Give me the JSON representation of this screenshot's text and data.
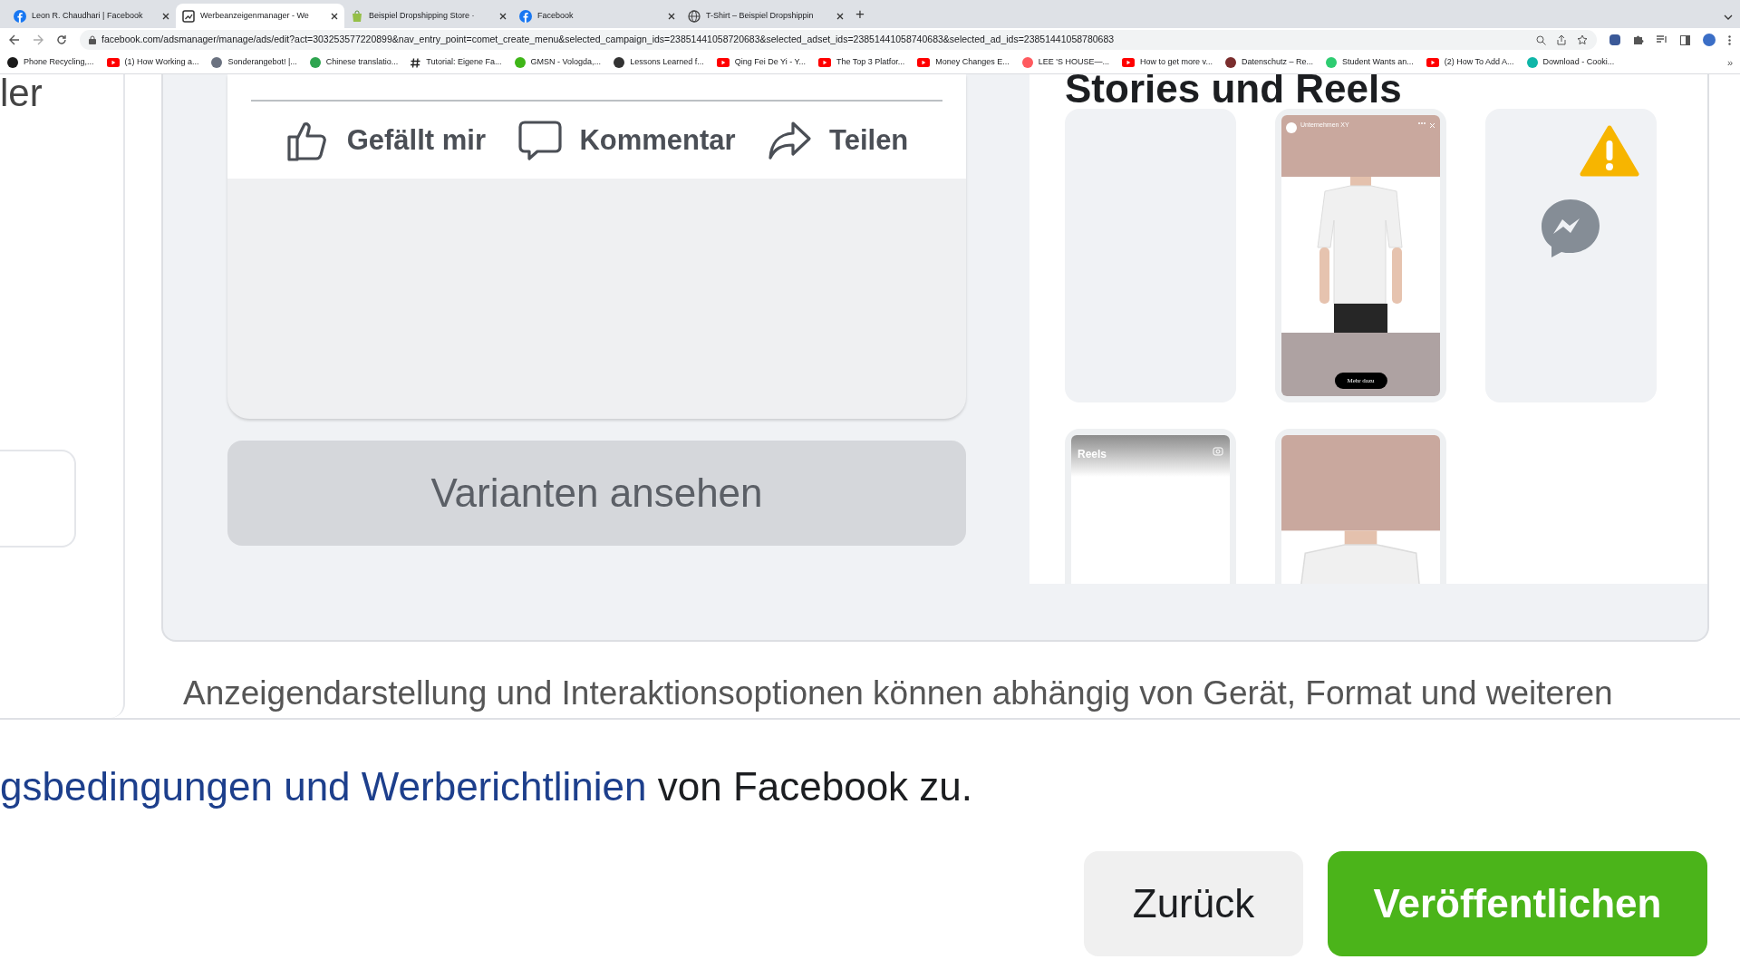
{
  "browser": {
    "tabs": [
      {
        "title": "Leon R. Chaudhari | Facebook",
        "kind": "facebook",
        "selected": false
      },
      {
        "title": "Werbeanzeigenmanager - We",
        "kind": "adsmanager",
        "selected": true
      },
      {
        "title": "Beispiel Dropshipping Store ·",
        "kind": "shop",
        "selected": false
      },
      {
        "title": "Facebook",
        "kind": "facebook",
        "selected": false
      },
      {
        "title": "T-Shirt – Beispiel Dropshippin",
        "kind": "globe",
        "selected": false
      }
    ],
    "new_tab": "+",
    "address": "facebook.com/adsmanager/manage/ads/edit?act=303253577220899&nav_entry_point=comet_create_menu&selected_campaign_ids=23851441058720683&selected_adset_ids=23851441058740683&selected_ad_ids=23851441058780683",
    "bookmarks": [
      {
        "label": "Phone Recycling,...",
        "kind": "dot",
        "color": "#1a1a1a"
      },
      {
        "label": "(1) How Working a...",
        "kind": "youtube"
      },
      {
        "label": "Sonderangebot! |...",
        "kind": "dot",
        "color": "#6b7280"
      },
      {
        "label": "Chinese translatio...",
        "kind": "dot",
        "color": "#2ea44f"
      },
      {
        "label": "Tutorial: Eigene Fa...",
        "kind": "hash"
      },
      {
        "label": "GMSN - Vologda,...",
        "kind": "dot",
        "color": "#3fb618"
      },
      {
        "label": "Lessons Learned f...",
        "kind": "dot",
        "color": "#333333"
      },
      {
        "label": "Qing Fei De Yi - Y...",
        "kind": "youtube"
      },
      {
        "label": "The Top 3 Platfor...",
        "kind": "youtube"
      },
      {
        "label": "Money Changes E...",
        "kind": "youtube"
      },
      {
        "label": "LEE 'S HOUSE—...",
        "kind": "dot",
        "color": "#ff5a5f"
      },
      {
        "label": "How to get more v...",
        "kind": "youtube"
      },
      {
        "label": "Datenschutz – Re...",
        "kind": "dot",
        "color": "#7a2d2d"
      },
      {
        "label": "Student Wants an...",
        "kind": "dot",
        "color": "#2ecc71"
      },
      {
        "label": "(2) How To Add A...",
        "kind": "youtube"
      },
      {
        "label": "Download - Cooki...",
        "kind": "dot",
        "color": "#0fb6a8"
      }
    ],
    "more_bookmarks": "»"
  },
  "left_panel": {
    "heading": "ler"
  },
  "preview": {
    "actions": [
      {
        "label": "Gefällt mir",
        "kind": "like"
      },
      {
        "label": "Kommentar",
        "kind": "comment"
      },
      {
        "label": "Teilen",
        "kind": "share"
      }
    ],
    "variants_button": "Varianten ansehen"
  },
  "stories": {
    "heading": "Stories und Reels",
    "cards": [
      {
        "kind": "empty"
      },
      {
        "kind": "story",
        "account": "Unternehmen XY",
        "cta": "Mehr dazu"
      },
      {
        "kind": "unsupported"
      },
      {
        "kind": "reels",
        "label": "Reels"
      },
      {
        "kind": "story_partial"
      }
    ]
  },
  "note": "Anzeigendarstellung und Interaktionsoptionen können abhängig von Gerät, Format und weiteren",
  "footer": {
    "terms_link": "gsbedingungen und Werberichtlinien",
    "terms_rest": " von Facebook zu.",
    "back": "Zurück",
    "publish": "Veröffentlichen"
  }
}
